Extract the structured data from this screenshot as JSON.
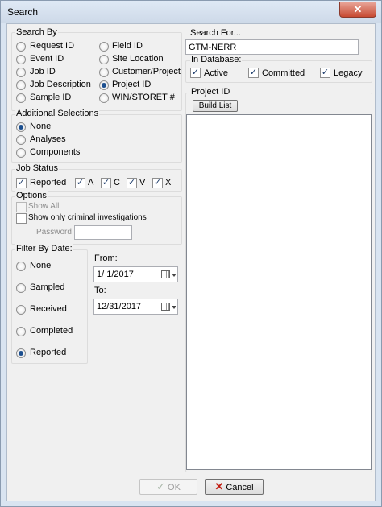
{
  "window": {
    "title": "Search",
    "close_label": "✕"
  },
  "search_by": {
    "title": "Search By",
    "col1": [
      "Request ID",
      "Event ID",
      "Job ID",
      "Job Description",
      "Sample ID"
    ],
    "col2": [
      "Field ID",
      "Site Location",
      "Customer/Project",
      "Project ID",
      "WIN/STORET #"
    ],
    "selected": "Project ID"
  },
  "additional": {
    "title": "Additional Selections",
    "options": [
      "None",
      "Analyses",
      "Components"
    ],
    "selected": "None"
  },
  "job_status": {
    "title": "Job Status",
    "items": [
      {
        "label": "Reported",
        "checked": true
      },
      {
        "label": "A",
        "checked": true
      },
      {
        "label": "C",
        "checked": true
      },
      {
        "label": "V",
        "checked": true
      },
      {
        "label": "X",
        "checked": true
      }
    ]
  },
  "options": {
    "title": "Options",
    "show_all": "Show All",
    "show_criminal": "Show only criminal investigations",
    "password_label": "Password",
    "password_value": ""
  },
  "filter_by_date": {
    "title": "Filter By Date:",
    "options": [
      "None",
      "Sampled",
      "Received",
      "Completed",
      "Reported"
    ],
    "selected": "Reported",
    "from_label": "From:",
    "from_value": "1/ 1/2017",
    "to_label": "To:",
    "to_value": "12/31/2017"
  },
  "search_for": {
    "title": "Search For...",
    "value": "GTM-NERR"
  },
  "in_database": {
    "title": "In Database:",
    "items": [
      {
        "label": "Active",
        "checked": true
      },
      {
        "label": "Committed",
        "checked": true
      },
      {
        "label": "Legacy",
        "checked": true
      }
    ]
  },
  "project_id": {
    "title": "Project ID",
    "build_list_label": "Build List"
  },
  "footer": {
    "ok_label": "OK",
    "cancel_label": "Cancel"
  },
  "colors": {
    "selection_blue": "#1c4f8f",
    "cancel_red": "#c21b10"
  }
}
